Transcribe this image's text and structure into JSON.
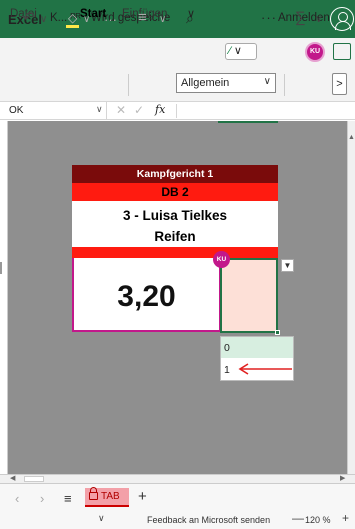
{
  "titlebar": {
    "app_name": "Excel",
    "doc_title": "K... ᴿᴿ - Wird gespeiche",
    "search_icon": "search-icon",
    "more": "···",
    "signin_label": "Anmelden",
    "accent_color": "#217346"
  },
  "ribbon_tabs": {
    "datei": "Datei",
    "start": "Start",
    "einfuegen": "Einfügen",
    "more": "∨",
    "avatar_initials": "KU",
    "avatar_color": "#c2188b"
  },
  "toolbar": {
    "number_format": "Allgemein",
    "sum_symbol": "∑",
    "more_symbol": ">"
  },
  "formula_bar": {
    "name_box": "OK",
    "fx_label": "fx"
  },
  "sheet": {
    "header_kampfgericht": "Kampfgericht 1",
    "header_db": "DB 2",
    "header_athlete": "3 - Luisa Tielkes",
    "header_apparatus": "Reifen",
    "score_value": "3,20",
    "presence_initials": "KU",
    "colors": {
      "dark_red": "#7a0b0b",
      "red": "#ff1b10",
      "input_fill": "#fde0d7",
      "presence": "#c2188b"
    }
  },
  "dropdown": {
    "options": [
      "0",
      "1"
    ],
    "highlighted_index": 0
  },
  "sheet_tabs": {
    "active_name": "TAB",
    "add_label": "+"
  },
  "status_bar": {
    "feedback": "Feedback an Microsoft senden",
    "zoom_minus": "—",
    "zoom_level": "120 %",
    "zoom_plus": "+"
  }
}
